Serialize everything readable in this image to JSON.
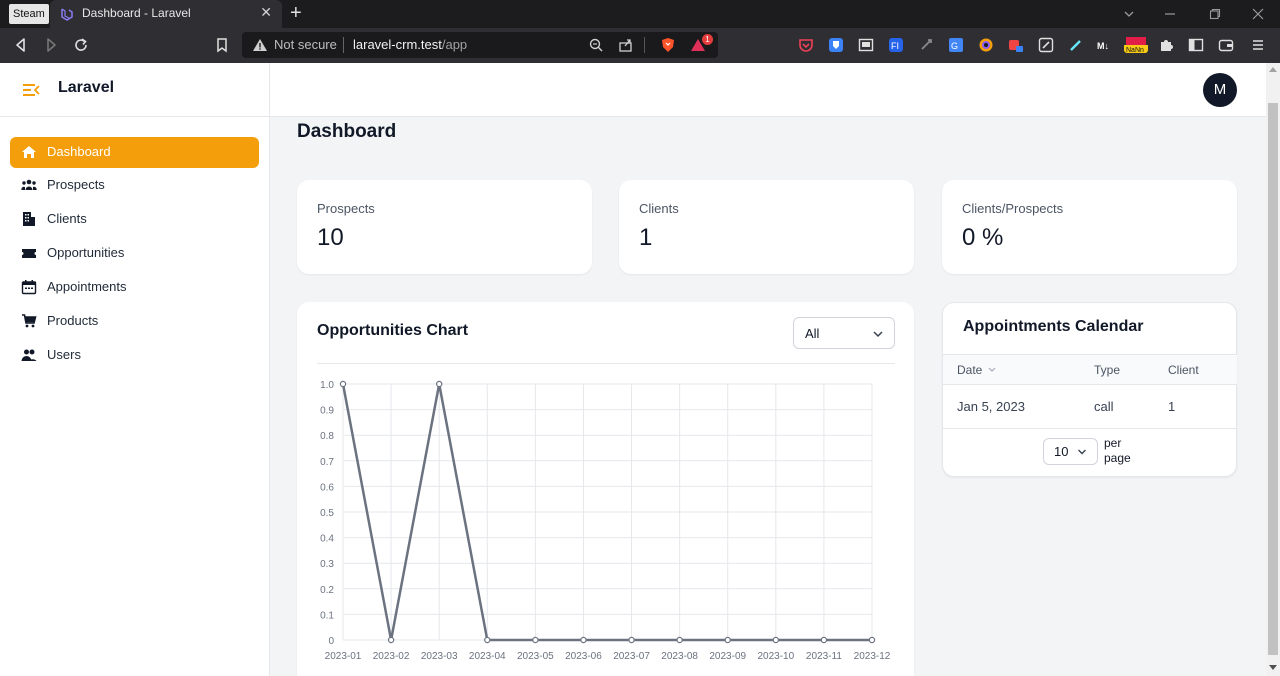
{
  "browser": {
    "steam_label": "Steam",
    "tab_title": "Dashboard - Laravel",
    "tab_close": "✕",
    "new_tab": "+",
    "not_secure": "Not secure",
    "url_host": "laravel-crm.test",
    "url_path": "/app",
    "notification_badge": "1"
  },
  "app": {
    "brand": "Laravel",
    "avatar_initial": "M",
    "accent_color": "#f59e0b"
  },
  "sidebar": {
    "items": [
      {
        "label": "Dashboard",
        "icon": "home-icon"
      },
      {
        "label": "Prospects",
        "icon": "users-group-icon"
      },
      {
        "label": "Clients",
        "icon": "building-icon"
      },
      {
        "label": "Opportunities",
        "icon": "ticket-icon"
      },
      {
        "label": "Appointments",
        "icon": "calendar-icon"
      },
      {
        "label": "Products",
        "icon": "cart-icon"
      },
      {
        "label": "Users",
        "icon": "users-icon"
      }
    ]
  },
  "page": {
    "title": "Dashboard"
  },
  "stats": [
    {
      "label": "Prospects",
      "value": "10"
    },
    {
      "label": "Clients",
      "value": "1"
    },
    {
      "label": "Clients/Prospects",
      "value": "0 %"
    }
  ],
  "opportunities": {
    "title": "Opportunities Chart",
    "filter_value": "All"
  },
  "calendar": {
    "title": "Appointments Calendar",
    "columns": [
      "Date",
      "Type",
      "Client"
    ],
    "rows": [
      {
        "date": "Jan 5, 2023",
        "type": "call",
        "client": "1"
      }
    ],
    "per_page_value": "10",
    "per_page_label": "per page"
  },
  "chart_data": {
    "type": "line",
    "x": [
      "2023-01",
      "2023-02",
      "2023-03",
      "2023-04",
      "2023-05",
      "2023-06",
      "2023-07",
      "2023-08",
      "2023-09",
      "2023-10",
      "2023-11",
      "2023-12"
    ],
    "series": [
      {
        "values": [
          1,
          0,
          1,
          0,
          0,
          0,
          0,
          0,
          0,
          0,
          0,
          0
        ]
      }
    ],
    "yticks": [
      "0",
      "0.1",
      "0.2",
      "0.3",
      "0.4",
      "0.5",
      "0.6",
      "0.7",
      "0.8",
      "0.9",
      "1.0"
    ],
    "ylim": [
      0,
      1
    ],
    "grid": true,
    "line_color": "#6b7280"
  }
}
